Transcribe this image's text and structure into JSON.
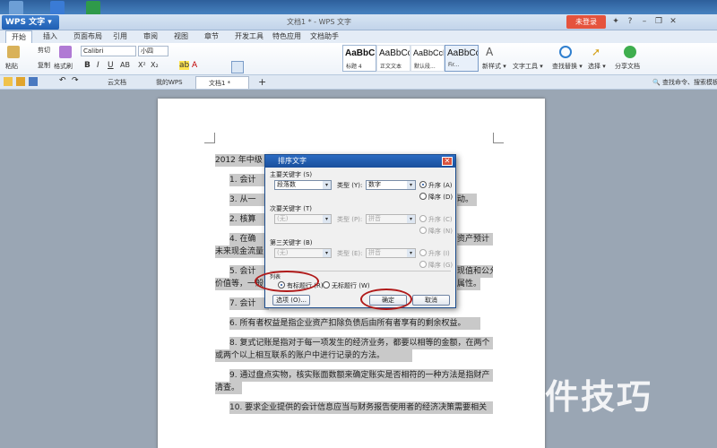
{
  "app": {
    "menu_button": "WPS 文字",
    "window_title": "文档1 * - WPS 文字",
    "login_button": "未登录"
  },
  "ribbon_tabs": [
    "开始",
    "插入",
    "页面布局",
    "引用",
    "审阅",
    "视图",
    "章节",
    "开发工具",
    "特色应用",
    "文档助手"
  ],
  "ribbon": {
    "paste": "粘贴",
    "cut": "剪切",
    "copy": "复制",
    "format_painter": "格式刷",
    "font_name": "Calibri",
    "font_size": "小四",
    "styles": [
      {
        "preview": "AaBbC",
        "name": "标题 4"
      },
      {
        "preview": "AaBbCc",
        "name": "正文文本"
      },
      {
        "preview": "AaBbCcD",
        "name": "默认段..."
      },
      {
        "preview": "AaBbCc",
        "name": "Fir..."
      }
    ],
    "new_style": "新样式",
    "text_tools": "文字工具",
    "find_replace": "查找替换",
    "select": "选择",
    "share_doc": "分享文档",
    "search_hint": "查找命令、搜索模板"
  },
  "doc_tabs": [
    "云文档",
    "我的WPS",
    "文档1 *"
  ],
  "document": {
    "lines": [
      "2012 年中级",
      "1.  会计",
      "3.  从一",
      "2.  核算",
      "4.  在确",
      "未来现金流量",
      "5.  会计",
      "价值等，一般",
      "7.  会计",
      "6.  所有者权益是指企业资产扣除负债后由所有者享有的剩余权益。",
      "8.  复式记账是指对于每一项发生的经济业务，都要以相等的金额，在两个",
      "或两个以上相互联系的账户中进行记录的方法。",
      "9.  通过盘点实物，核实账面数额来确定账实是否相符的一种方法是指财产",
      "清查。",
      "10.  要求企业提供的会计信息应当与财务报告使用者的经济决策需要相关"
    ],
    "right_fragments": [
      "动。",
      "资产预计",
      "现值和公允",
      "属性。"
    ]
  },
  "dialog": {
    "title": "排序文字",
    "primary_key_label": "主要关键字 (S)",
    "primary_key_value": "段落数",
    "type_label": "类型 (Y):",
    "primary_type_value": "数字",
    "asc": "升序 (A)",
    "desc": "降序 (D)",
    "secondary_key_label": "次要关键字 (T)",
    "secondary_key_value": "(无)",
    "secondary_type_label": "类型 (P):",
    "secondary_type_value": "拼音",
    "secondary_asc": "升序 (C)",
    "secondary_desc": "降序 (N)",
    "third_key_label": "第三关键字 (B)",
    "third_key_value": "(无)",
    "third_type_label": "类型 (E):",
    "third_type_value": "拼音",
    "third_asc": "升序 (I)",
    "third_desc": "降序 (G)",
    "list_label": "列表",
    "has_header": "有标题行 (R)",
    "no_header": "无标题行 (W)",
    "options_button": "选项 (O)...",
    "ok_button": "确定",
    "cancel_button": "取消"
  },
  "watermark": "软件技巧"
}
